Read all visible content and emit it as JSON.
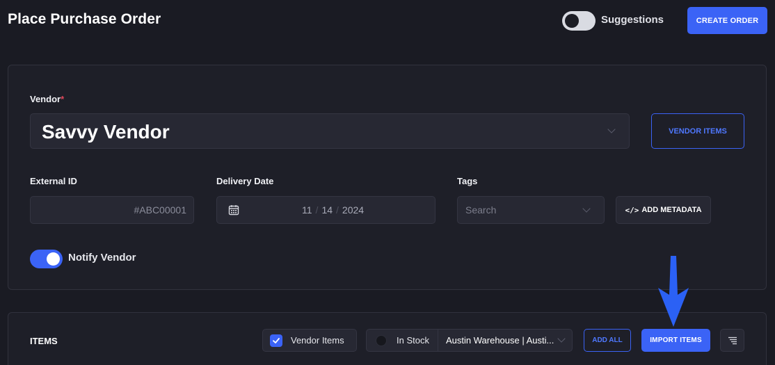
{
  "header": {
    "title": "Place Purchase Order",
    "suggestions_label": "Suggestions",
    "suggestions_on": false,
    "create_order_label": "CREATE ORDER"
  },
  "vendor": {
    "label": "Vendor",
    "required_mark": "*",
    "selected": "Savvy Vendor",
    "vendor_items_label": "VENDOR ITEMS"
  },
  "external_id": {
    "label": "External ID",
    "placeholder": "#ABC00001",
    "value": ""
  },
  "delivery_date": {
    "label": "Delivery Date",
    "month": "11",
    "day": "14",
    "year": "2024",
    "separator": "/"
  },
  "tags": {
    "label": "Tags",
    "placeholder": "Search"
  },
  "add_metadata_label": "ADD METADATA",
  "notify": {
    "label": "Notify Vendor",
    "on": true
  },
  "items": {
    "title": "ITEMS",
    "vendor_items_filter_label": "Vendor Items",
    "vendor_items_checked": true,
    "in_stock_label": "In Stock",
    "in_stock_checked": false,
    "warehouse": "Austin Warehouse | Austi...",
    "add_all_label": "ADD ALL",
    "import_items_label": "IMPORT ITEMS"
  },
  "colors": {
    "background": "#1a1b23",
    "card": "#1e1f28",
    "accent": "#3b63f6",
    "required": "#e0475a"
  },
  "icons": [
    "chevron-down-icon",
    "calendar-icon",
    "code-icon",
    "check-icon",
    "filter-list-icon",
    "arrow-down-annotation"
  ]
}
